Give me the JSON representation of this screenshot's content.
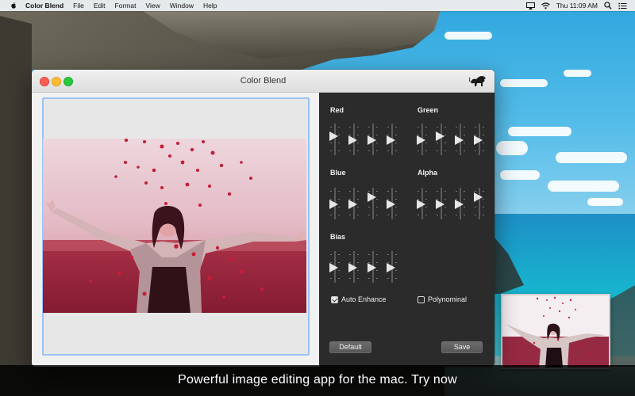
{
  "menubar": {
    "app_name": "Color Blend",
    "menus": [
      "File",
      "Edit",
      "Format",
      "View",
      "Window",
      "Help"
    ],
    "clock": "Thu 11:09 AM"
  },
  "window": {
    "title": "Color Blend"
  },
  "panel": {
    "groups": {
      "red": {
        "label": "Red",
        "levels": [
          0.35,
          0.55,
          0.55,
          0.55
        ]
      },
      "green": {
        "label": "Green",
        "levels": [
          0.55,
          0.35,
          0.55,
          0.55
        ]
      },
      "blue": {
        "label": "Blue",
        "levels": [
          0.55,
          0.55,
          0.2,
          0.55
        ]
      },
      "alpha": {
        "label": "Alpha",
        "levels": [
          0.55,
          0.55,
          0.55,
          0.2
        ]
      },
      "bias": {
        "label": "Bias",
        "levels": [
          0.55,
          0.55,
          0.55,
          0.55
        ]
      }
    },
    "auto_enhance": {
      "label": "Auto Enhance",
      "checked": true
    },
    "polynominal": {
      "label": "Polynominal",
      "checked": false
    },
    "default_button": "Default",
    "save_button": "Save"
  },
  "caption": "Powerful image editing app for the mac. Try now"
}
